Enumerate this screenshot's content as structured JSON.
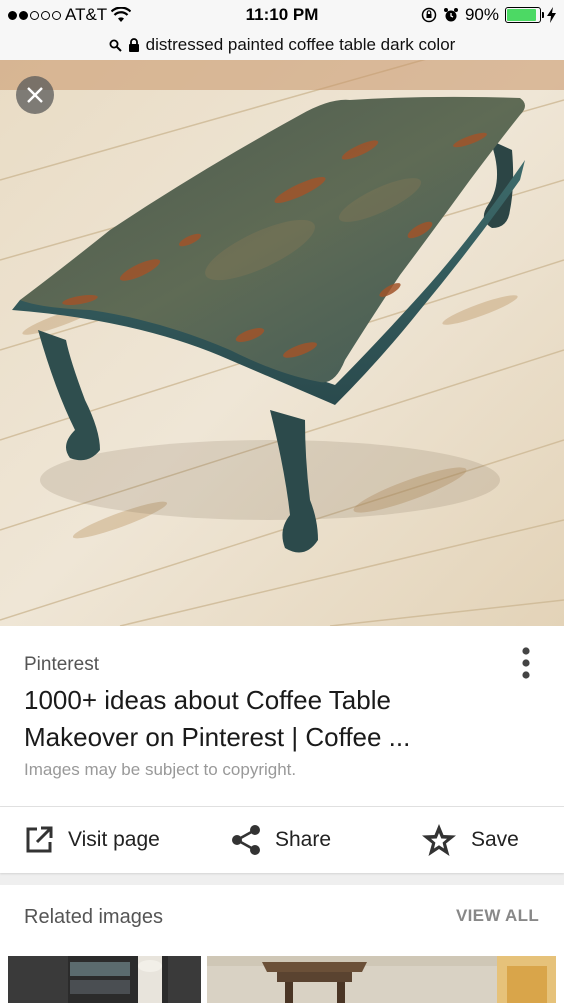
{
  "status": {
    "carrier": "AT&T",
    "time": "11:10 PM",
    "battery": "90%",
    "battery_level": 0.9,
    "signal_bars": 2,
    "battery_color": "#4cd964"
  },
  "url_bar": {
    "query": "distressed painted coffee table dark color"
  },
  "result": {
    "source": "Pinterest",
    "title": "1000+ ideas about Coffee Table Makeover on Pinterest | Coffee ...",
    "copyright": "Images may be subject to copyright."
  },
  "actions": {
    "visit": "Visit page",
    "share": "Share",
    "save": "Save"
  },
  "related": {
    "title": "Related images",
    "view_all": "VIEW ALL"
  },
  "icons": {
    "close": "close-icon",
    "more": "more-vert-icon",
    "visit": "open-external-icon",
    "share": "share-icon",
    "save": "star-icon",
    "search": "search-icon",
    "lock": "lock-icon",
    "wifi": "wifi-icon",
    "alarm": "alarm-icon"
  }
}
